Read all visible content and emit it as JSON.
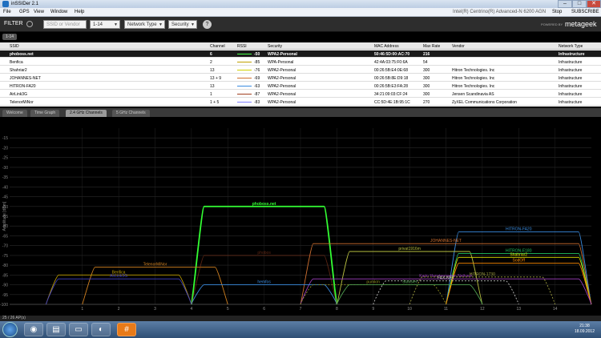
{
  "window": {
    "title": "inSSIDer 2.1",
    "minimize": "–",
    "maximize": "□",
    "close": "✕"
  },
  "menu": {
    "items": [
      "File",
      "GPS",
      "View",
      "Window",
      "Help"
    ],
    "adapter": "Intel(R) Centrino(R) Advanced-N 6200 AGN",
    "stop": "Stop",
    "subscribe": "SUBSCRIBE"
  },
  "filter": {
    "label": "FILTER",
    "ssid_placeholder": "SSID or Vendor",
    "channel": "1-14",
    "network_type": "Network Type",
    "security": "Security",
    "help": "?",
    "powered_by": "POWERED BY",
    "brand": "metageek",
    "active_chip": "1-14"
  },
  "table": {
    "headers": [
      "SSID",
      "Channel",
      "RSSI",
      "Security",
      "MAC Address",
      "Max Rate",
      "Vendor",
      "Network Type"
    ],
    "rows": [
      {
        "ssid": "phoboss.net",
        "channel": "6",
        "rssi": "-50",
        "security": "WPA2-Personal",
        "mac": "50:46:5D:00:AC:70",
        "rate": "216",
        "vendor": "",
        "type": "Infrastructure",
        "color": "#44ff44"
      },
      {
        "ssid": "Benfica",
        "channel": "2",
        "rssi": "-85",
        "security": "WPA-Personal",
        "mac": "42:4A:03:75:F0:6A",
        "rate": "54",
        "vendor": "",
        "type": "Infrastructure",
        "color": "#c0a000"
      },
      {
        "ssid": "Shahriar2",
        "channel": "13",
        "rssi": "-76",
        "security": "WPA2-Personal",
        "mac": "00:26:5B:E4:0E:68",
        "rate": "300",
        "vendor": "Hitron Technologies. Inc",
        "type": "Infrastructure",
        "color": "#d0d000"
      },
      {
        "ssid": "JOHANNES-NET",
        "channel": "13 + 9",
        "rssi": "-69",
        "security": "WPA2-Personal",
        "mac": "00:26:5B:8E:D9:18",
        "rate": "300",
        "vendor": "Hitron Technologies. Inc",
        "type": "Infrastructure",
        "color": "#d07030"
      },
      {
        "ssid": "HITRON-FA20",
        "channel": "13",
        "rssi": "-63",
        "security": "WPA2-Personal",
        "mac": "00:26:5B:E3:FA:28",
        "rate": "300",
        "vendor": "Hitron Technologies. Inc",
        "type": "Infrastructure",
        "color": "#3a8ce0"
      },
      {
        "ssid": "AirLink3G",
        "channel": "1",
        "rssi": "-87",
        "security": "WPA2-Personal",
        "mac": "34:21:09:03:CF:24",
        "rate": "300",
        "vendor": "Jensen Scandinavia AS",
        "type": "Infrastructure",
        "color": "#a04020"
      },
      {
        "ssid": "TelenorMiNor",
        "channel": "1 + 5",
        "rssi": "-83",
        "security": "WPA2-Personal",
        "mac": "CC:5D:4E:1B:95:1C",
        "rate": "270",
        "vendor": "ZyXEL Communications Corporation",
        "type": "Infrastructure",
        "color": "#8080ff"
      }
    ]
  },
  "tabs": [
    {
      "label": "Welcome"
    },
    {
      "label": "Time Graph"
    },
    {
      "label": "2.4 GHz Channels"
    },
    {
      "label": "5 GHz Channels"
    }
  ],
  "active_tab": "2.4 GHz Channels",
  "chart_data": {
    "type": "line",
    "ylabel": "Amplitude [dBm]",
    "ylim": [
      -100,
      -10
    ],
    "yticks": [
      -15,
      -20,
      -25,
      -30,
      -35,
      -40,
      -45,
      -50,
      -55,
      -60,
      -65,
      -70,
      -75,
      -80,
      -85,
      -90,
      -95,
      -100
    ],
    "xticks": [
      "1",
      "2",
      "3",
      "4",
      "5",
      "6",
      "7",
      "8",
      "9",
      "10",
      "11",
      "12",
      "13",
      "14"
    ],
    "xlim": [
      -1,
      15
    ],
    "series": [
      {
        "name": "phoboss.net",
        "channel": 6,
        "width": 2,
        "rssi": -50,
        "color": "#33ff33",
        "style": "solid",
        "emph": true
      },
      {
        "name": "HITRON-FA20",
        "channel": 13,
        "width": 2,
        "rssi": -63,
        "color": "#3a8ce0",
        "style": "solid"
      },
      {
        "name": "JOHANNES-NET",
        "channel": 11,
        "width": 4,
        "rssi": -69,
        "color": "#d07030",
        "style": "solid"
      },
      {
        "name": "privat1916m",
        "channel": 10,
        "width": 2,
        "rssi": -73,
        "color": "#b8c040",
        "style": "solid"
      },
      {
        "name": "HITRON-E180",
        "channel": 13,
        "width": 2,
        "rssi": -74,
        "color": "#20c060",
        "style": "solid"
      },
      {
        "name": "Shahriar2",
        "channel": 13,
        "width": 2,
        "rssi": -76,
        "color": "#e0e000",
        "style": "solid"
      },
      {
        "name": "SodOff",
        "channel": 13,
        "width": 2,
        "rssi": -79,
        "color": "#ff8c00",
        "style": "solid"
      },
      {
        "name": "TelenorMiNor",
        "channel": 3,
        "width": 2,
        "rssi": -81,
        "color": "#d08020",
        "style": "solid"
      },
      {
        "name": "Benfica",
        "channel": 2,
        "width": 2,
        "rssi": -85,
        "color": "#c0a000",
        "style": "solid"
      },
      {
        "name": "AirLink3G",
        "channel": 2,
        "width": 2,
        "rssi": -87,
        "color": "#4040c0",
        "style": "solid"
      },
      {
        "name": "Karin Hansteenveien Nettverk",
        "channel": 11,
        "width": 4,
        "rssi": -87,
        "color": "#a040c0",
        "style": "solid"
      },
      {
        "name": "HITRON-1730",
        "channel": 12,
        "width": 2,
        "rssi": -86,
        "color": "#a0a040",
        "style": "dashed"
      },
      {
        "name": "FAX-NET",
        "channel": 11,
        "width": 2,
        "rssi": -88,
        "color": "#c0c0c0",
        "style": "dashed"
      },
      {
        "name": "hemfos",
        "channel": 6,
        "width": 2,
        "rssi": -90,
        "color": "#3a8ce0",
        "style": "solid"
      },
      {
        "name": "pumkrn",
        "channel": 9,
        "width": 2,
        "rssi": -90,
        "color": "#909020",
        "style": "dashed"
      },
      {
        "name": "Stanslet",
        "channel": 10,
        "width": 2,
        "rssi": -90,
        "color": "#50a050",
        "style": "solid"
      },
      {
        "name": "phobos",
        "channel": 6,
        "width": 2,
        "rssi": -75,
        "color": "#a04020",
        "style": "solid",
        "dim": true
      }
    ]
  },
  "status": {
    "count": "25 / 26 AP(s)"
  },
  "taskbar": {
    "time": "21:38",
    "date": "18.09.2012"
  }
}
